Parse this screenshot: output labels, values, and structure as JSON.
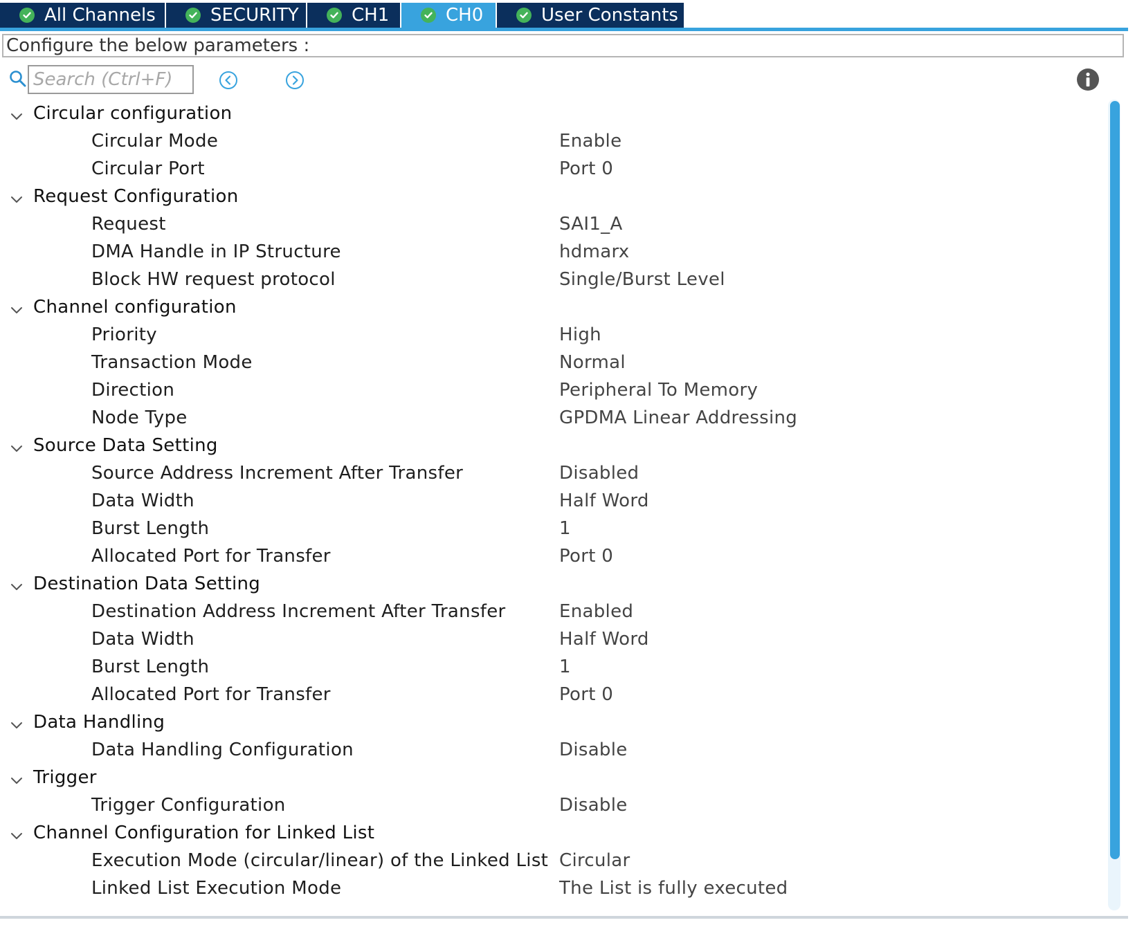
{
  "colors": {
    "tab_bg": "#0b2f5c",
    "tab_active_bg": "#38a3de",
    "check_green": "#44b35a",
    "accent_blue": "#38a3de"
  },
  "tabs": [
    {
      "label": "All Channels",
      "icon": "check-circle-icon",
      "active": false
    },
    {
      "label": "SECURITY",
      "icon": "check-circle-icon",
      "active": false
    },
    {
      "label": "CH1",
      "icon": "check-circle-icon",
      "active": false
    },
    {
      "label": "CH0",
      "icon": "check-circle-icon",
      "active": true
    },
    {
      "label": "User Constants",
      "icon": "check-circle-icon",
      "active": false
    }
  ],
  "header": {
    "configure_text": "Configure the below parameters :"
  },
  "search": {
    "placeholder": "Search (Ctrl+F)",
    "value": ""
  },
  "groups": [
    {
      "label": "Circular configuration",
      "params": [
        {
          "label": "Circular Mode",
          "value": "Enable"
        },
        {
          "label": "Circular Port",
          "value": "Port 0"
        }
      ]
    },
    {
      "label": "Request Configuration",
      "params": [
        {
          "label": "Request",
          "value": "SAI1_A"
        },
        {
          "label": "DMA Handle in IP Structure",
          "value": "hdmarx"
        },
        {
          "label": "Block HW request protocol",
          "value": "Single/Burst Level"
        }
      ]
    },
    {
      "label": "Channel configuration",
      "params": [
        {
          "label": "Priority",
          "value": "High"
        },
        {
          "label": "Transaction Mode",
          "value": "Normal"
        },
        {
          "label": "Direction",
          "value": "Peripheral To Memory"
        },
        {
          "label": "Node Type",
          "value": "GPDMA Linear Addressing"
        }
      ]
    },
    {
      "label": "Source Data Setting",
      "params": [
        {
          "label": "Source Address Increment After Transfer",
          "value": "Disabled"
        },
        {
          "label": "Data Width",
          "value": "Half Word"
        },
        {
          "label": "Burst Length",
          "value": "1"
        },
        {
          "label": "Allocated Port for Transfer",
          "value": "Port 0"
        }
      ]
    },
    {
      "label": "Destination Data Setting",
      "params": [
        {
          "label": "Destination Address Increment After Transfer",
          "value": "Enabled"
        },
        {
          "label": "Data Width",
          "value": "Half Word"
        },
        {
          "label": "Burst Length",
          "value": "1"
        },
        {
          "label": "Allocated Port for Transfer",
          "value": "Port 0"
        }
      ]
    },
    {
      "label": "Data Handling",
      "params": [
        {
          "label": "Data Handling Configuration",
          "value": "Disable"
        }
      ]
    },
    {
      "label": "Trigger",
      "params": [
        {
          "label": "Trigger Configuration",
          "value": "Disable"
        }
      ]
    },
    {
      "label": "Channel Configuration for Linked List",
      "params": [
        {
          "label": "Execution Mode (circular/linear) of the Linked List",
          "value": "Circular"
        },
        {
          "label": "Linked List Execution Mode",
          "value": "The List is fully executed"
        }
      ]
    }
  ]
}
